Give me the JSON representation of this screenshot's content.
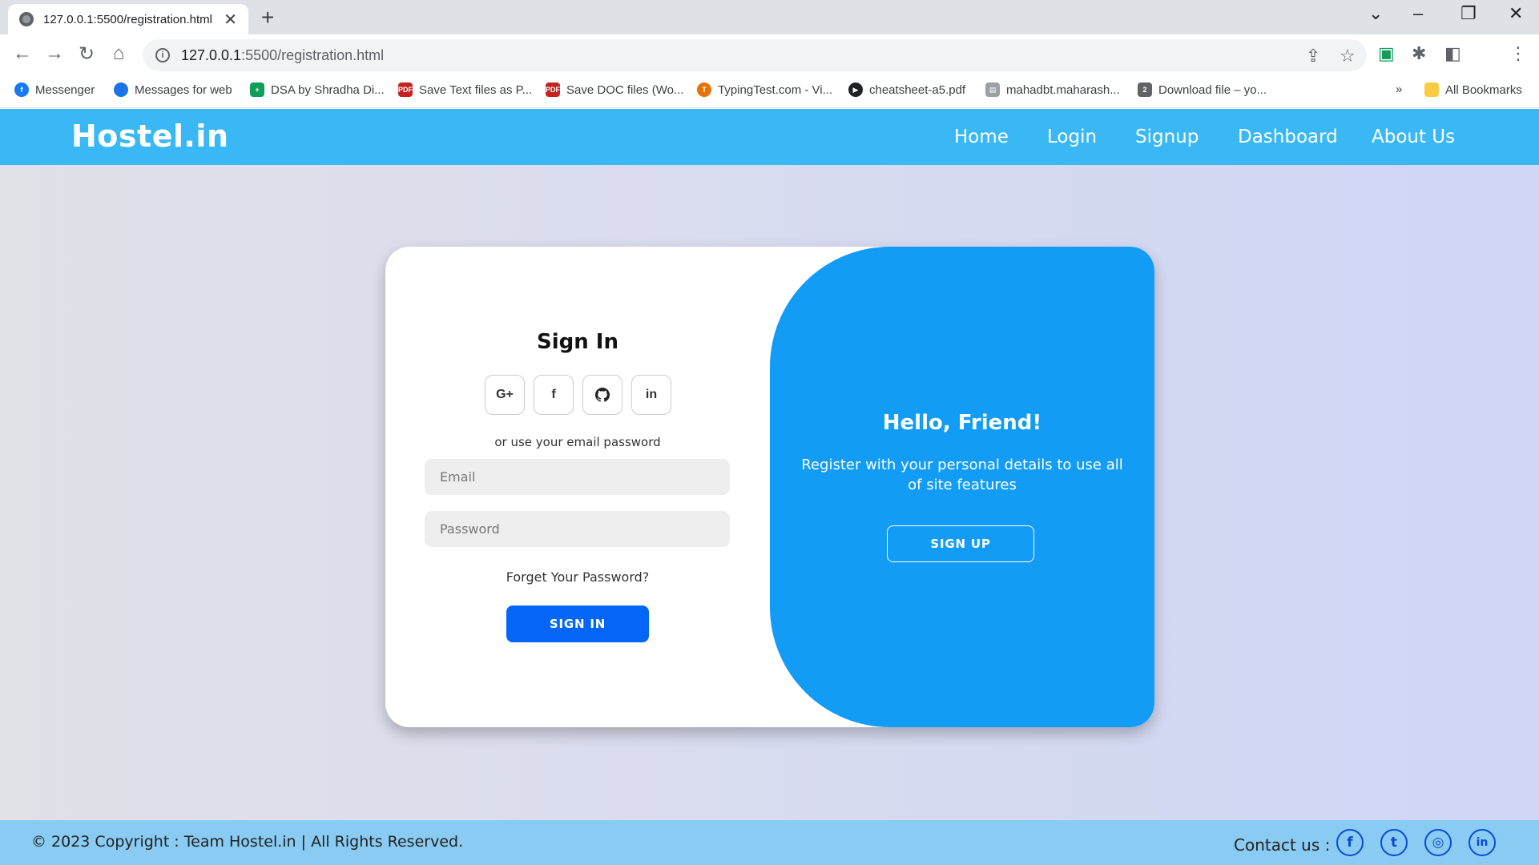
{
  "browser": {
    "tab_title": "127.0.0.1:5500/registration.html",
    "tab_close": "✕",
    "new_tab": "+",
    "url_host": "127.0.0.1",
    "url_path": ":5500/registration.html",
    "bookmarks": [
      {
        "label": "Messenger",
        "color": "#1877f2",
        "glyph": "f"
      },
      {
        "label": "Messages for web",
        "color": "#1a73e8",
        "glyph": ""
      },
      {
        "label": "DSA by Shradha Di...",
        "color": "#0f9d58",
        "glyph": "+"
      },
      {
        "label": "Save Text files as P...",
        "color": "#c5221f",
        "glyph": "PDF"
      },
      {
        "label": "Save DOC files (Wo...",
        "color": "#c5221f",
        "glyph": "PDF"
      },
      {
        "label": "TypingTest.com - Vi...",
        "color": "#e8710a",
        "glyph": "T"
      },
      {
        "label": "cheatsheet-a5.pdf",
        "color": "#202124",
        "glyph": "▶"
      },
      {
        "label": "mahadbt.maharash...",
        "color": "#9aa0a6",
        "glyph": "▤"
      },
      {
        "label": "Download file – yo...",
        "color": "#5f6368",
        "glyph": "2"
      }
    ],
    "bookmarks_overflow": "»",
    "all_bookmarks": "All Bookmarks"
  },
  "header": {
    "brand": "Hostel.in",
    "nav": [
      "Home",
      "Login",
      "Signup",
      "Dashboard",
      "About Us"
    ]
  },
  "signin": {
    "title": "Sign In",
    "social": [
      "G+",
      "f",
      "⌂",
      "in"
    ],
    "or_text": "or use your email password",
    "email_placeholder": "Email",
    "password_placeholder": "Password",
    "forgot": "Forget Your Password?",
    "button": "SIGN IN"
  },
  "panel": {
    "heading": "Hello, Friend!",
    "text": "Register with your personal details to use all of site features",
    "button": "SIGN UP"
  },
  "footer": {
    "copyright": "© 2023 Copyright : Team Hostel.in | All Rights Reserved.",
    "contact": "Contact us :",
    "icons": [
      "f",
      "t",
      "◎",
      "in"
    ]
  },
  "colors": {
    "header": "#3ab8f5",
    "panel": "#129cf6",
    "signin_button": "#0466f8",
    "footer": "#89cbf2"
  }
}
